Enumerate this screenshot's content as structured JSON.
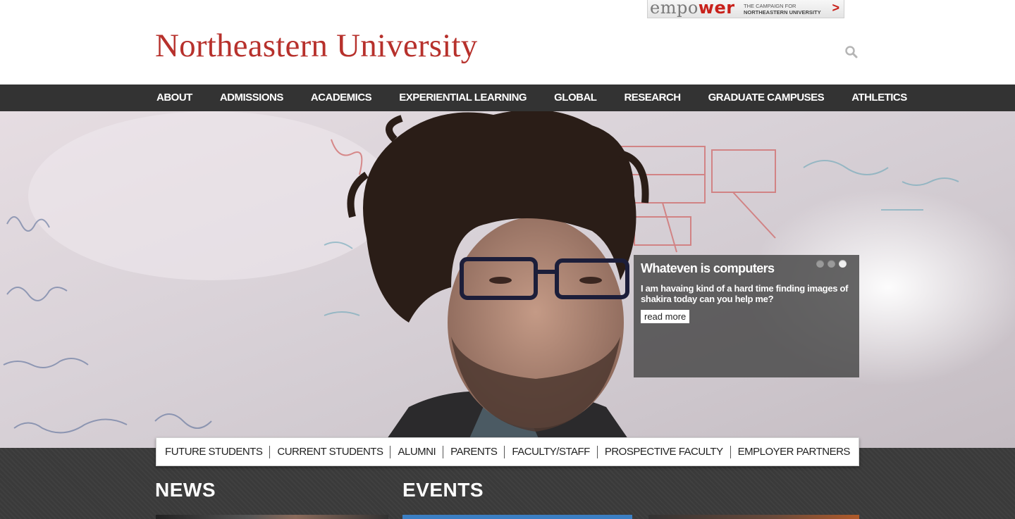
{
  "header": {
    "wordmark": "Northeastern University",
    "empower": {
      "word_start": "empo",
      "word_highlight": "wer",
      "tagline_line1": "THE CAMPAIGN FOR",
      "tagline_line2": "NORTHEASTERN UNIVERSITY",
      "arrow": ">"
    },
    "search_icon": "search-icon"
  },
  "main_nav": {
    "items": [
      "ABOUT",
      "ADMISSIONS",
      "ACADEMICS",
      "EXPERIENTIAL LEARNING",
      "GLOBAL",
      "RESEARCH",
      "GRADUATE CAMPUSES",
      "ATHLETICS"
    ]
  },
  "hero": {
    "caption": {
      "title": "Whateven is computers",
      "text": "I am havaing kind of a hard time finding images of shakira today can you help me?",
      "button": "read more"
    },
    "slide_count": 3,
    "active_slide": 3
  },
  "audience_nav": {
    "items": [
      "FUTURE STUDENTS",
      "CURRENT STUDENTS",
      "ALUMNI",
      "PARENTS",
      "FACULTY/STAFF",
      "PROSPECTIVE FACULTY",
      "EMPLOYER PARTNERS"
    ]
  },
  "sections": {
    "news": "NEWS",
    "events": "EVENTS"
  },
  "colors": {
    "brand_red": "#b7312c",
    "nav_bg": "#333333",
    "caption_bg": "#464646"
  }
}
